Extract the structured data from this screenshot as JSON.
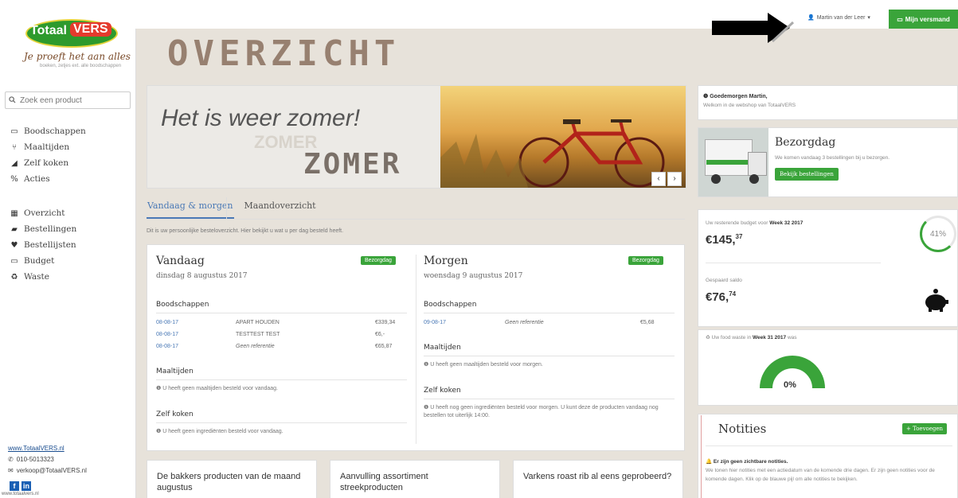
{
  "brand": {
    "name_part1": "Totaal",
    "name_part2": "VERS",
    "slogan": "Je proeft het aan alles",
    "slogan_sub": "boeken, zetjes ext. alle boodschappen"
  },
  "search": {
    "placeholder": "Zoek een product"
  },
  "nav_main": [
    {
      "label": "Boodschappen",
      "icon": "basket-icon"
    },
    {
      "label": "Maaltijden",
      "icon": "cutlery-icon"
    },
    {
      "label": "Zelf koken",
      "icon": "pan-icon"
    },
    {
      "label": "Acties",
      "icon": "percent-icon"
    }
  ],
  "nav_account": [
    {
      "label": "Overzicht",
      "icon": "calendar-icon"
    },
    {
      "label": "Bestellingen",
      "icon": "truck-icon"
    },
    {
      "label": "Bestellijsten",
      "icon": "heart-icon"
    },
    {
      "label": "Budget",
      "icon": "money-icon"
    },
    {
      "label": "Waste",
      "icon": "recycle-icon"
    }
  ],
  "contact": {
    "website": "www.TotaalVERS.nl",
    "phone": "010-5013323",
    "email": "verkoop@TotaalVERS.nl",
    "footer_url": "www.totaalvers.nl"
  },
  "topbar": {
    "user": "Martin van der Leer",
    "cart": "Mijn versmand"
  },
  "page_title": "OVERZICHT",
  "banner": {
    "title": "Het is weer zomer!",
    "ghost": "ZOMER",
    "word": "ZOMER"
  },
  "tabs": [
    "Vandaag & morgen",
    "Maandoverzicht"
  ],
  "intro": "Dit is uw persoonlijke besteloverzicht. Hier bekijkt u wat u per dag besteld heeft.",
  "today": {
    "title": "Vandaag",
    "date": "dinsdag 8 augustus 2017",
    "badge": "Bezorgdag",
    "groceries_heading": "Boodschappen",
    "rows": [
      {
        "date": "08-08-17",
        "ref": "APART HOUDEN",
        "amount": "€339,34"
      },
      {
        "date": "08-08-17",
        "ref": "TESTTEST TEST",
        "amount": "€6,-"
      },
      {
        "date": "08-08-17",
        "ref": "Geen referentie",
        "amount": "€65,87"
      }
    ],
    "meals_heading": "Maaltijden",
    "meals_info": "U heeft geen maaltijden besteld voor vandaag.",
    "cook_heading": "Zelf koken",
    "cook_info": "U heeft geen ingrediënten besteld voor vandaag."
  },
  "tomorrow": {
    "title": "Morgen",
    "date": "woensdag 9 augustus 2017",
    "badge": "Bezorgdag",
    "groceries_heading": "Boodschappen",
    "rows": [
      {
        "date": "09-08-17",
        "ref": "Geen referentie",
        "amount": "€5,68"
      }
    ],
    "meals_heading": "Maaltijden",
    "meals_info": "U heeft geen maaltijden besteld voor morgen.",
    "cook_heading": "Zelf koken",
    "cook_info": "U heeft nog geen ingrediënten besteld voor morgen. U kunt deze de producten vandaag nog bestellen tot uiterlijk 14:00."
  },
  "cards": [
    "De bakkers producten van de maand augustus",
    "Aanvulling assortiment streekproducten",
    "Varkens roast rib al eens geprobeerd?"
  ],
  "greeting": {
    "title": "Goedemorgen Martin,",
    "sub": "Welkom in de webshop van TotaalVERS"
  },
  "delivery": {
    "title": "Bezorgdag",
    "sub": "We komen vandaag 3 bestellingen bij u bezorgen.",
    "button": "Bekijk bestellingen"
  },
  "budget": {
    "label_prefix": "Uw resterende budget voor",
    "week": "Week 32 2017",
    "amount_main": "€145,",
    "amount_cents": "37",
    "percent": "41%",
    "percent_value": 41,
    "savings_label": "Gespaard saldo",
    "savings_main": "€76,",
    "savings_cents": "74"
  },
  "waste": {
    "label_prefix": "Uw food waste in",
    "week": "Week 31 2017",
    "label_suffix": "was",
    "value": "0%"
  },
  "notes": {
    "title": "Notities",
    "add": "Toevoegen",
    "info_title": "Er zijn geen zichtbare notities.",
    "info_text": "We tonen hier notities met een actiedatum van de komende drie dagen. Er zijn geen notities voor de komende dagen. Klik op de blauwe pijl om alle notities te bekijken."
  },
  "colors": {
    "brand_green": "#3aa43a",
    "link_blue": "#4a79b6",
    "brand_red": "#e53a2d"
  }
}
